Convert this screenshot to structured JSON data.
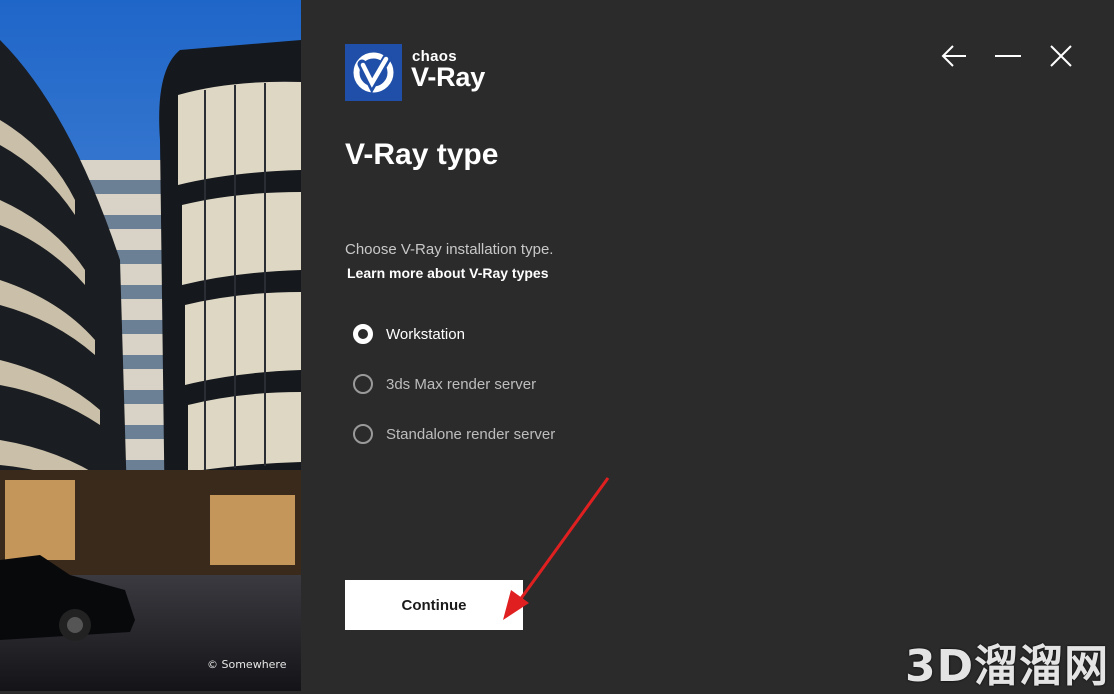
{
  "hero": {
    "credit": "© Somewhere"
  },
  "logo": {
    "brand": "chaos",
    "product": "V-Ray"
  },
  "window_controls": {
    "back": "back-arrow-icon",
    "minimize": "minimize-icon",
    "close": "close-icon"
  },
  "page": {
    "title": "V-Ray type",
    "description": "Choose V-Ray installation type.",
    "learn_more": "Learn more about V-Ray types"
  },
  "options": [
    {
      "label": "Workstation",
      "selected": true
    },
    {
      "label": "3ds Max render server",
      "selected": false
    },
    {
      "label": "Standalone render server",
      "selected": false
    }
  ],
  "continue_label": "Continue",
  "watermark": "3D溜溜网",
  "colors": {
    "panel": "#2b2b2b",
    "logo_blue": "#1f4fa8",
    "annotation_red": "#e02020"
  }
}
